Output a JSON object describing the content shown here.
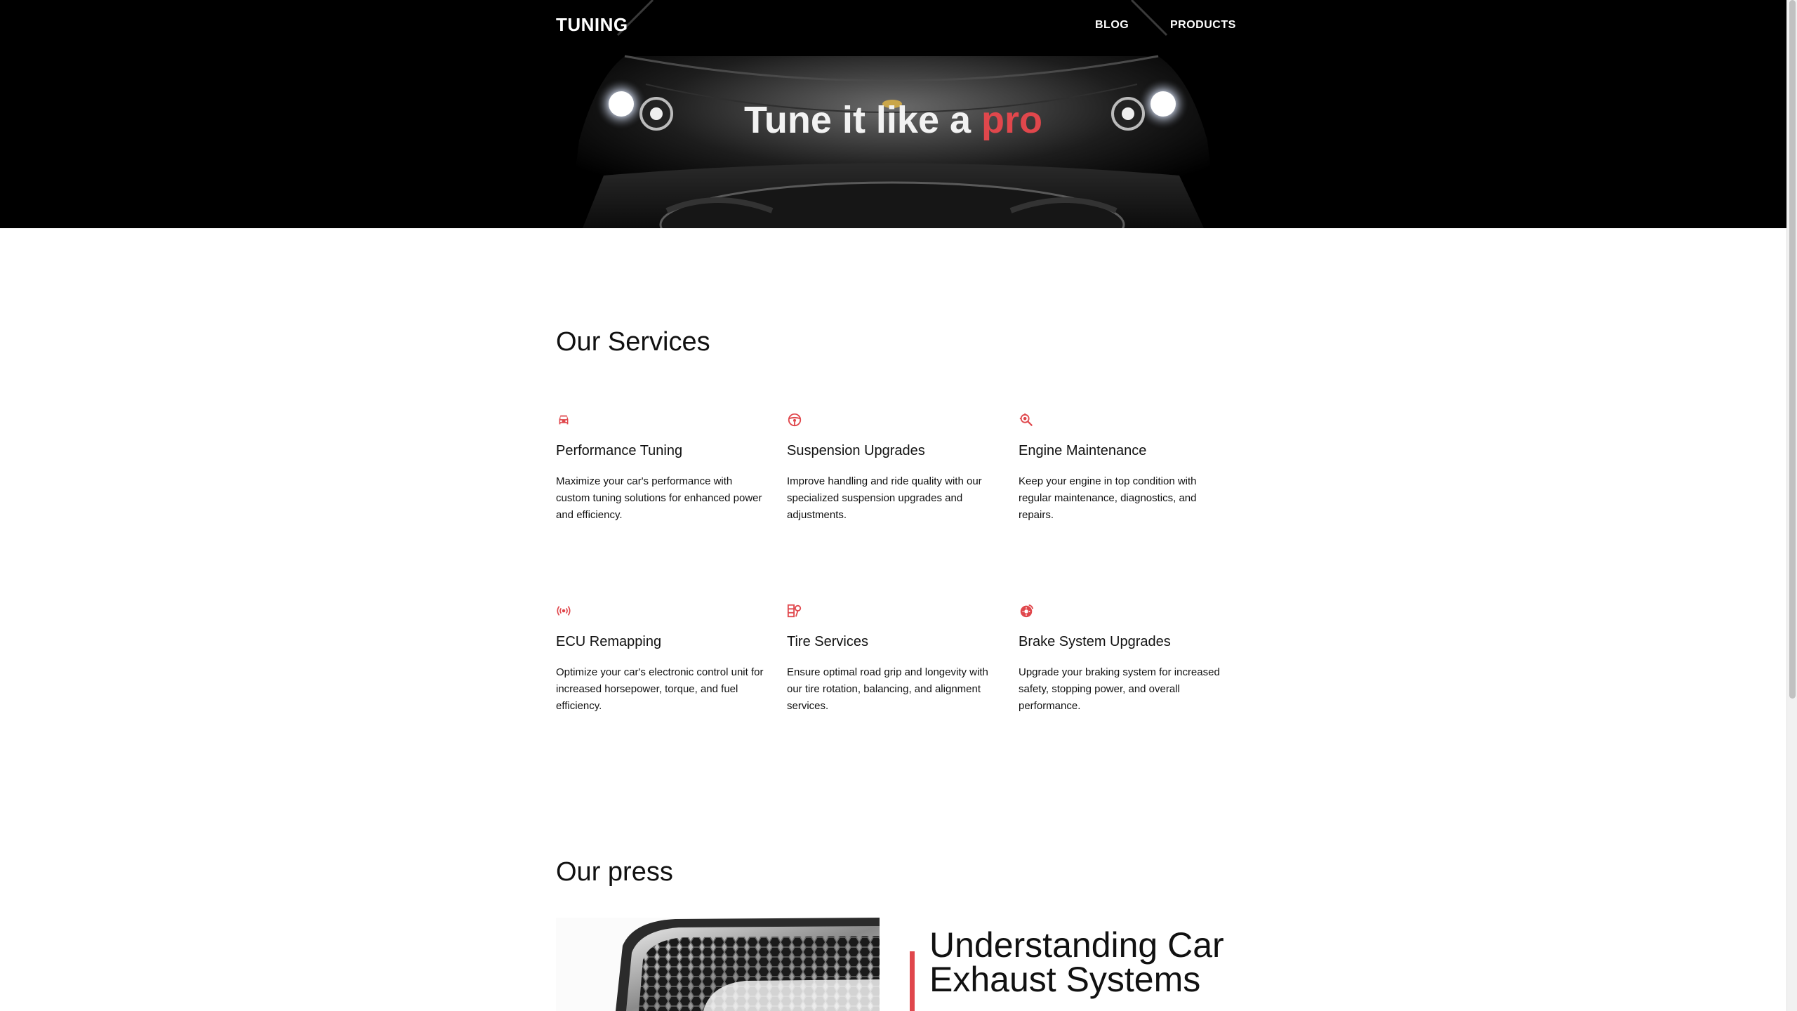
{
  "nav": {
    "brand": "TUNING",
    "links": [
      "BLOG",
      "PRODUCTS"
    ]
  },
  "hero": {
    "title_main": "Tune it like a ",
    "title_accent": "pro"
  },
  "services": {
    "title": "Our Services",
    "items": [
      {
        "icon": "car-icon",
        "name": "Performance Tuning",
        "description": "Maximize your car's performance with custom tuning solutions for enhanced power and efficiency."
      },
      {
        "icon": "steering-wheel-icon",
        "name": "Suspension Upgrades",
        "description": "Improve handling and ride quality with our specialized suspension upgrades and adjustments."
      },
      {
        "icon": "engine-search-icon",
        "name": "Engine Maintenance",
        "description": "Keep your engine in top condition with regular maintenance, diagnostics, and repairs."
      },
      {
        "icon": "signal-broadcast-icon",
        "name": "ECU Remapping",
        "description": "Optimize your car's electronic control unit for increased horsepower, torque, and fuel efficiency."
      },
      {
        "icon": "tire-pressure-icon",
        "name": "Tire Services",
        "description": "Ensure optimal road grip and longevity with our tire rotation, balancing, and alignment services."
      },
      {
        "icon": "brake-disc-icon",
        "name": "Brake System Upgrades",
        "description": "Upgrade your braking system for increased safety, stopping power, and overall performance."
      }
    ]
  },
  "press": {
    "title": "Our press",
    "headline": "Understanding Car Exhaust Systems"
  },
  "colors": {
    "accent": "#e0474c",
    "hero_bg": "#000000",
    "text": "#111111"
  }
}
